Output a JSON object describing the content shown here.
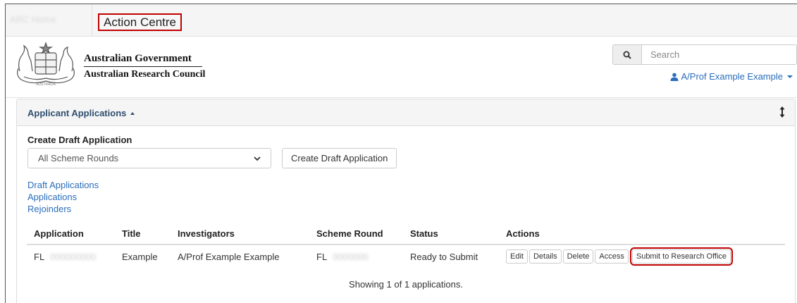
{
  "tabbar": {
    "blurred_tab": "ARC Home",
    "active_tab": "Action Centre"
  },
  "header": {
    "gov_name": "Australian Government",
    "council_name": "Australian Research Council",
    "logo_icon": "commonwealth-coat-of-arms",
    "search_icon": "search-icon",
    "search_placeholder": "Search",
    "user_name": "A/Prof Example Example",
    "user_icon": "user-icon"
  },
  "panel": {
    "title": "Applicant Applications",
    "create_label": "Create Draft Application",
    "scheme_select_value": "All Scheme Rounds",
    "create_button": "Create Draft Application",
    "links": [
      "Draft Applications",
      "Applications",
      "Rejoinders"
    ]
  },
  "table": {
    "headers": [
      "Application",
      "Title",
      "Investigators",
      "Scheme Round",
      "Status",
      "Actions"
    ],
    "rows": [
      {
        "application": "FL",
        "application_hidden": "000000000",
        "title": "Example",
        "investigators": "A/Prof Example Example",
        "scheme_round": "FL",
        "scheme_round_hidden": "0000000",
        "status": "Ready to Submit",
        "actions": [
          "Edit",
          "Details",
          "Delete",
          "Access",
          "Submit to Research Office"
        ]
      }
    ],
    "footer": "Showing 1 of 1 applications."
  },
  "colors": {
    "highlight": "#c00000",
    "link": "#2a6ebb",
    "panel_heading": "#2f4f6f"
  }
}
